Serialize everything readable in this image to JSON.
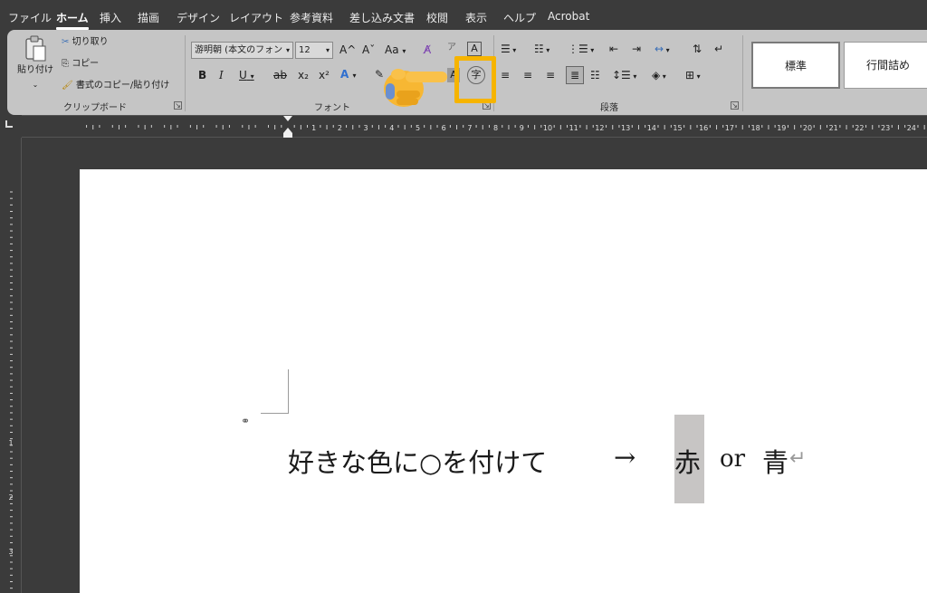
{
  "tabs": [
    {
      "label": "ファイル"
    },
    {
      "label": "ホーム",
      "active": true
    },
    {
      "label": "挿入"
    },
    {
      "label": "描画"
    },
    {
      "label": "デザイン"
    },
    {
      "label": "レイアウト"
    },
    {
      "label": "参考資料"
    },
    {
      "label": "差し込み文書"
    },
    {
      "label": "校閲"
    },
    {
      "label": "表示"
    },
    {
      "label": "ヘルプ"
    },
    {
      "label": "Acrobat"
    }
  ],
  "clipboard": {
    "paste_label": "貼り付け",
    "cut_label": "切り取り",
    "copy_label": "コピー",
    "format_painter_label": "書式のコピー/貼り付け",
    "group_label": "クリップボード"
  },
  "font": {
    "font_name": "游明朝 (本文のフォン",
    "font_size": "12",
    "grow": "A^",
    "shrink": "Aˇ",
    "case": "Aa",
    "bold": "B",
    "italic": "I",
    "underline": "U",
    "strike": "ab",
    "subscript": "x₂",
    "superscript": "x²",
    "effects": "A",
    "char_border": "A",
    "enclose_char": "字",
    "group_label": "フォント"
  },
  "paragraph": {
    "group_label": "段落"
  },
  "styles": [
    {
      "label": "標準",
      "selected": true
    },
    {
      "label": "行間詰め"
    }
  ],
  "ruler": {
    "numbers": [
      "1",
      "2",
      "3",
      "4",
      "5",
      "6",
      "7",
      "8",
      "9",
      "10",
      "11",
      "12",
      "13",
      "14",
      "15",
      "16",
      "17",
      "18",
      "19",
      "20",
      "21",
      "22",
      "23",
      "24"
    ],
    "vnumbers": [
      "1",
      "2",
      "3"
    ]
  },
  "document": {
    "text_main": "好きな色に○を付けて",
    "arrow": "→",
    "option_red": "赤",
    "or_text": "or",
    "option_blue": "青",
    "para_mark": "↵"
  },
  "colors": {
    "highlight_box": "#f6b400",
    "ribbon_bg": "#c5c5c5",
    "app_bg": "#3b3b3b",
    "selection_bg": "#c7c5c4"
  }
}
